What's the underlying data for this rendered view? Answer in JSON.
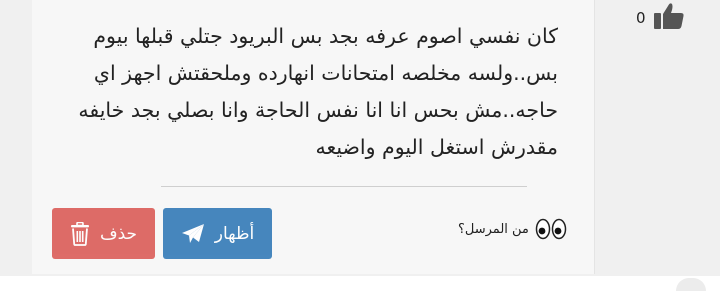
{
  "message": {
    "lines": [
      "كان نفسي اصوم عرفه بجد بس البريود جتلي قبلها بيوم",
      "بس..ولسه مخلصه امتحانات انهارده وملحقتش اجهز اي",
      "حاجه..مش بحس انا انا نفس الحاجة وانا بصلي بجد خايفه",
      "مقدرش استغل اليوم واضيعه"
    ]
  },
  "actions": {
    "show_label": "أظهار",
    "delete_label": "حذف"
  },
  "sender": {
    "label": "من المرسل؟",
    "icon": "eyes-icon"
  },
  "like": {
    "count": "0",
    "icon": "thumbs-up-icon"
  },
  "colors": {
    "delete_button": "#d9534f",
    "show_button": "#337ab7",
    "card_background": "#f7f7f7"
  }
}
